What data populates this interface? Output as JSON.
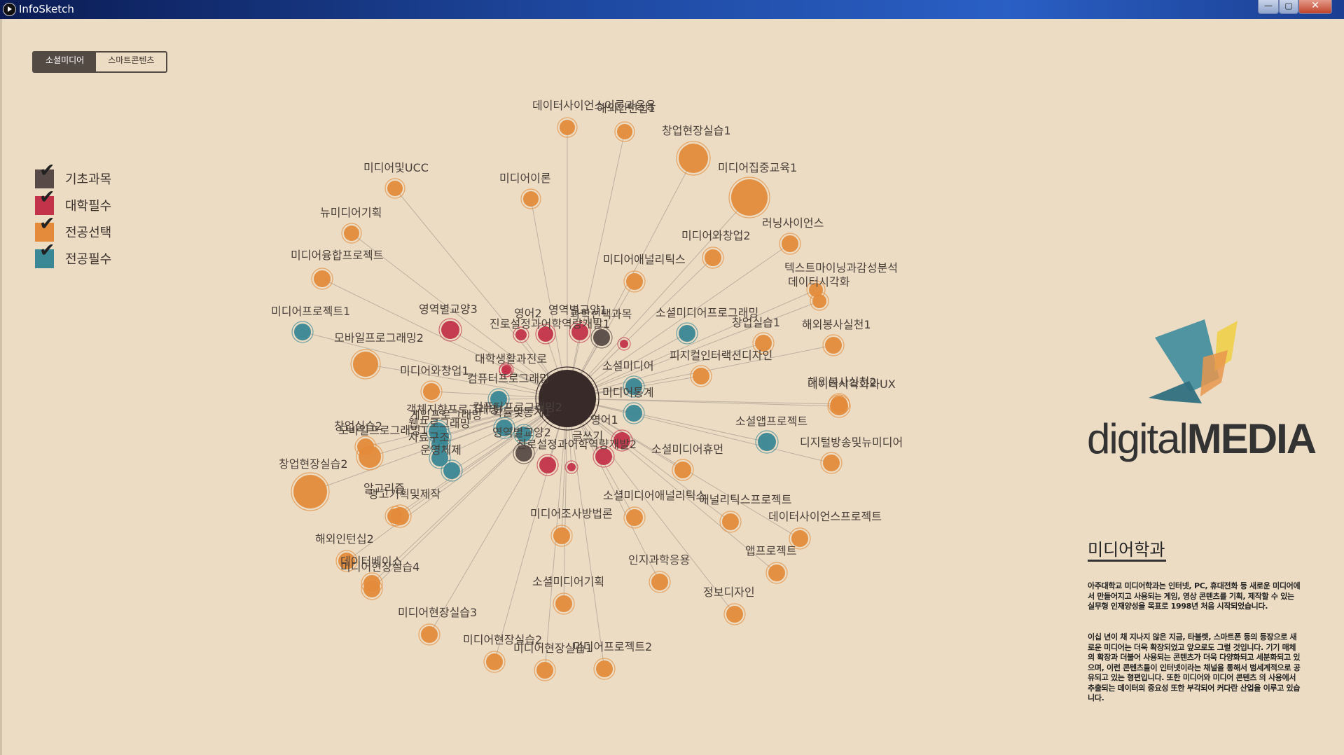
{
  "window": {
    "title": "InfoSketch",
    "min_label": "—",
    "max_label": "▢",
    "close_label": "✕"
  },
  "tabs": [
    {
      "label": "소셜미디어",
      "active": true
    },
    {
      "label": "스마트콘텐츠",
      "active": false
    }
  ],
  "legend": [
    {
      "label": "기초과목",
      "color": "#584a46"
    },
    {
      "label": "대학필수",
      "color": "#c3334a"
    },
    {
      "label": "전공선택",
      "color": "#e48b3b"
    },
    {
      "label": "전공필수",
      "color": "#3a8795"
    }
  ],
  "colors": {
    "background": "#ecdcc4",
    "center": "#372a28",
    "edge": "#bdb0a0"
  },
  "center_node": {
    "label": ""
  },
  "nodes": [
    {
      "label": "데이터사이언스이론과응용",
      "cat": 2
    },
    {
      "label": "해외인턴십1",
      "cat": 2
    },
    {
      "label": "창업현장실습1",
      "cat": 2
    },
    {
      "label": "미디어집중교육1",
      "cat": 2
    },
    {
      "label": "미디어및UCC",
      "cat": 2
    },
    {
      "label": "미디어이론",
      "cat": 2
    },
    {
      "label": "뉴미디어기획",
      "cat": 2
    },
    {
      "label": "러닝사이언스",
      "cat": 2
    },
    {
      "label": "미디어와창업2",
      "cat": 2
    },
    {
      "label": "미디어애널리틱스",
      "cat": 2
    },
    {
      "label": "미디어융합프로젝트",
      "cat": 2
    },
    {
      "label": "텍스트마이닝과감성분석",
      "cat": 2
    },
    {
      "label": "데이터시각화",
      "cat": 2
    },
    {
      "label": "미디어프로젝트1",
      "cat": 3
    },
    {
      "label": "영역별교양3",
      "cat": 1
    },
    {
      "label": "영어2",
      "cat": 1
    },
    {
      "label": "영역별교양1",
      "cat": 1
    },
    {
      "label": "소셜미디어프로그래밍",
      "cat": 3
    },
    {
      "label": "진로설정과어학역량개발1",
      "cat": 1
    },
    {
      "label": "과학선택과목",
      "cat": 0
    },
    {
      "label": "창업실습1",
      "cat": 2
    },
    {
      "label": "해외봉사실천1",
      "cat": 2
    },
    {
      "label": "모바일프로그래밍2",
      "cat": 2
    },
    {
      "label": "대학생활과진로",
      "cat": 1
    },
    {
      "label": "피지컬인터랙션디자인",
      "cat": 2
    },
    {
      "label": "미디어와창업1",
      "cat": 2
    },
    {
      "label": "컴퓨터프로그래밍",
      "cat": 3
    },
    {
      "label": "소셜미디어",
      "cat": 3
    },
    {
      "label": "미디어통계",
      "cat": 3
    },
    {
      "label": "데이터시각화와UX",
      "cat": 2
    },
    {
      "label": "해외봉사실천2",
      "cat": 2
    },
    {
      "label": "컴퓨터프로그래밍2",
      "cat": 3
    },
    {
      "label": "객체지향프로그래밍",
      "cat": 3
    },
    {
      "label": "웹프로그래밍",
      "cat": 3
    },
    {
      "label": "창업실습2",
      "cat": 2
    },
    {
      "label": "모바일프로그래밍1",
      "cat": 2
    },
    {
      "label": "자료구조",
      "cat": 3
    },
    {
      "label": "운영체제",
      "cat": 3
    },
    {
      "label": "게임프로그래밍",
      "cat": 3
    },
    {
      "label": "확률및통계1",
      "cat": 3
    },
    {
      "label": "영어1",
      "cat": 1
    },
    {
      "label": "글쓰기",
      "cat": 1
    },
    {
      "label": "영역별교양2",
      "cat": 0
    },
    {
      "label": "진로설정과어학역량개발2",
      "cat": 1
    },
    {
      "label": "소셜미디어휴먼",
      "cat": 2
    },
    {
      "label": "소셜앱프로젝트",
      "cat": 3
    },
    {
      "label": "디지털방송및뉴미디어",
      "cat": 2
    },
    {
      "label": "창업현장실습2",
      "cat": 2
    },
    {
      "label": "광고기획및제작",
      "cat": 2
    },
    {
      "label": "알고리즘",
      "cat": 2
    },
    {
      "label": "소셜미디어애널리틱스",
      "cat": 2
    },
    {
      "label": "애널리틱스프로젝트",
      "cat": 2
    },
    {
      "label": "미디어조사방법론",
      "cat": 2
    },
    {
      "label": "데이터사이언스프로젝트",
      "cat": 2
    },
    {
      "label": "해외인턴십2",
      "cat": 2
    },
    {
      "label": "데이터베이스",
      "cat": 2
    },
    {
      "label": "미디어현장실습4",
      "cat": 2
    },
    {
      "label": "앱프로젝트",
      "cat": 2
    },
    {
      "label": "인지과학응용",
      "cat": 2
    },
    {
      "label": "소셜미디어기획",
      "cat": 2
    },
    {
      "label": "정보디자인",
      "cat": 2
    },
    {
      "label": "미디어현장실습3",
      "cat": 2
    },
    {
      "label": "미디어현장실습2",
      "cat": 2
    },
    {
      "label": "미디어현장실습1",
      "cat": 2
    },
    {
      "label": "미디어프로젝트2",
      "cat": 2
    },
    {
      "label": "",
      "cat": 1
    },
    {
      "label": "",
      "cat": 1
    },
    {
      "label": "",
      "cat": 1
    }
  ],
  "logo": {
    "text_light": "digital",
    "text_bold": "MEDIA"
  },
  "department": {
    "title": "미디어학과",
    "paragraph1": "아주대학교 미디어학과는 인터넷, PC, 휴대전화 등 새로운 미디어에서 만들어지고 사용되는 게임, 영상 콘텐츠를 기획, 제작할 수 있는 실무형 인재양성을 목표로 1998년 처음 시작되었습니다.",
    "paragraph2": "이십 년이 채 지나지 않은 지금, 타블렛, 스마트폰 등의 등장으로 새로운 미디어는 더욱 확장되었고 앞으로도 그럴 것입니다. 기기 매체의 확장과 더불어 사용되는 콘텐츠가 더욱 다양화되고 세분화되고 있으며, 이런 콘텐츠들이 인터넷이라는 채널을 통해서 범세계적으로 공유되고 있는 형편입니다. 또한 미디어와 미디어 콘텐츠 의 사용에서 추출되는 데이터의 중요성 또한 부각되어 커다란 산업을 이루고 있습니다."
  }
}
